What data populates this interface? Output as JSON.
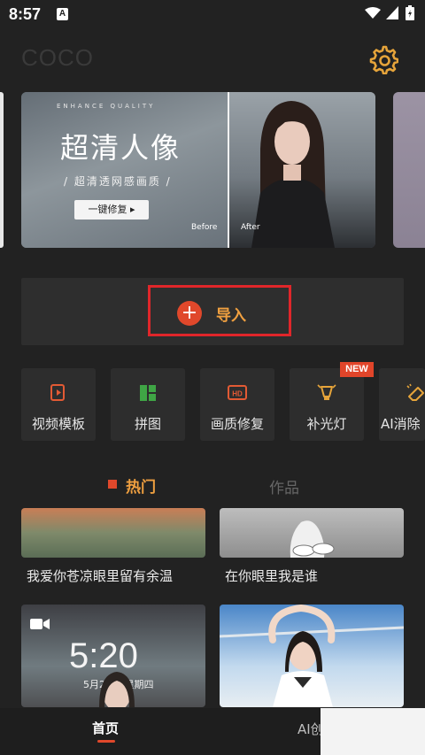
{
  "status": {
    "time": "8:57",
    "notif_letter": "A"
  },
  "header": {
    "title": "COCO",
    "settings_icon": "gear-icon"
  },
  "banner": {
    "en_tag": "ENHANCE QUALITY",
    "title": "超清人像",
    "subtitle": "/ 超清透网感画质 /",
    "cta": "一键修复 ▸",
    "before": "Before",
    "after": "After"
  },
  "import": {
    "label": "导入",
    "icon": "plus-icon"
  },
  "tools": [
    {
      "label": "视频模板",
      "icon": "video-template-icon"
    },
    {
      "label": "拼图",
      "icon": "collage-icon"
    },
    {
      "label": "画质修复",
      "icon": "hd-icon"
    },
    {
      "label": "补光灯",
      "icon": "fill-light-icon"
    },
    {
      "label": "AI消除",
      "icon": "eraser-icon"
    }
  ],
  "new_badge": "NEW",
  "tabs": {
    "hot": "热门",
    "works": "作品"
  },
  "feed": [
    {
      "caption": "我爱你苍凉眼里留有余温"
    },
    {
      "caption": "在你眼里我是谁"
    }
  ],
  "lockscreen": {
    "time": "5:20",
    "date": "5月20日 星期四"
  },
  "bottom_nav": {
    "home": "首页",
    "ai": "AI创作"
  },
  "colors": {
    "accent_orange": "#f0a040",
    "accent_red": "#e0482b",
    "highlight_red": "#e0262a",
    "background": "#222222"
  }
}
